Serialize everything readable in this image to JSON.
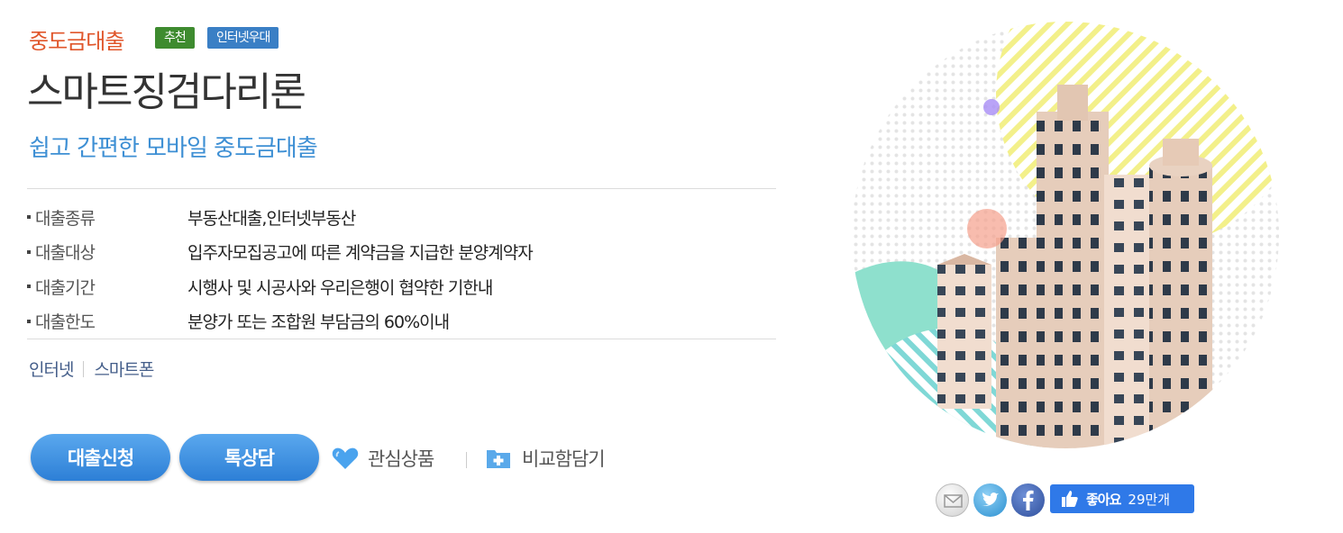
{
  "product": {
    "category": "중도금대출",
    "badges": [
      "추천",
      "인터넷우대"
    ],
    "title": "스마트징검다리론",
    "subtitle": "쉽고 간편한 모바일 중도금대출"
  },
  "info": [
    {
      "label": "대출종류",
      "value": "부동산대출,인터넷부동산"
    },
    {
      "label": "대출대상",
      "value": "입주자모집공고에 따른 계약금을 지급한 분양계약자"
    },
    {
      "label": "대출기간",
      "value": "시행사 및 시공사와 우리은행이 협약한 기한내"
    },
    {
      "label": "대출한도",
      "value": "분양가 또는 조합원 부담금의 60%이내"
    }
  ],
  "channels": [
    "인터넷",
    "스마트폰"
  ],
  "actions": {
    "apply": "대출신청",
    "consult": "톡상담",
    "favorite": "관심상품",
    "compare": "비교함담기"
  },
  "share": {
    "icons": [
      "mail-icon",
      "twitter-icon",
      "facebook-icon"
    ],
    "like_label": "좋아요",
    "like_count": "29만개"
  },
  "colors": {
    "category": "#e0562b",
    "badge_recommend": "#3e8b2f",
    "badge_internet": "#3a7fc5",
    "subtitle": "#3d8fd4",
    "button": "#2d7fd6",
    "facebook_like": "#2f79e8"
  }
}
